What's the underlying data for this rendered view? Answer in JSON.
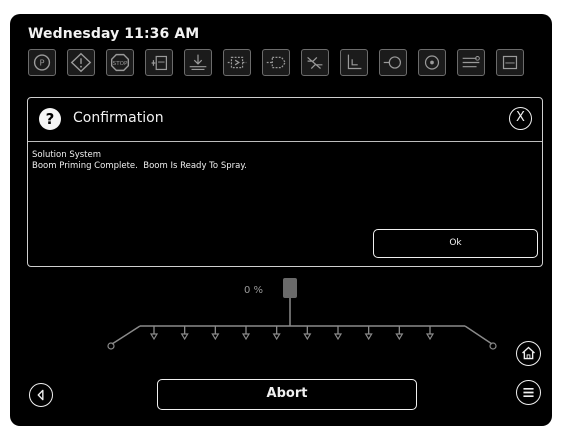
{
  "header": {
    "datetime": "Wednesday 11:36 AM"
  },
  "status_icons": [
    "park-brake-icon",
    "warning-icon",
    "stop-icon",
    "tank-level-icon",
    "boom-height-icon",
    "valve-icon",
    "section-valve-icon",
    "nozzle-off-icon",
    "tank-fill-icon",
    "pump-icon",
    "agitator-icon",
    "rinse-icon",
    "display-icon"
  ],
  "dialog": {
    "title": "Confirmation",
    "close_label": "X",
    "message_line1": "Solution System",
    "message_line2": "Boom Priming Complete.  Boom Is Ready To Spray.",
    "ok_label": "Ok"
  },
  "boom": {
    "percent_label": "0 %",
    "nozzle_count": 10
  },
  "footer": {
    "abort_label": "Abort"
  },
  "colors": {
    "background": "#000000",
    "foreground": "#f0f0f0",
    "icon_border": "#6c6c6c",
    "boom_line": "#8a8a8a"
  }
}
